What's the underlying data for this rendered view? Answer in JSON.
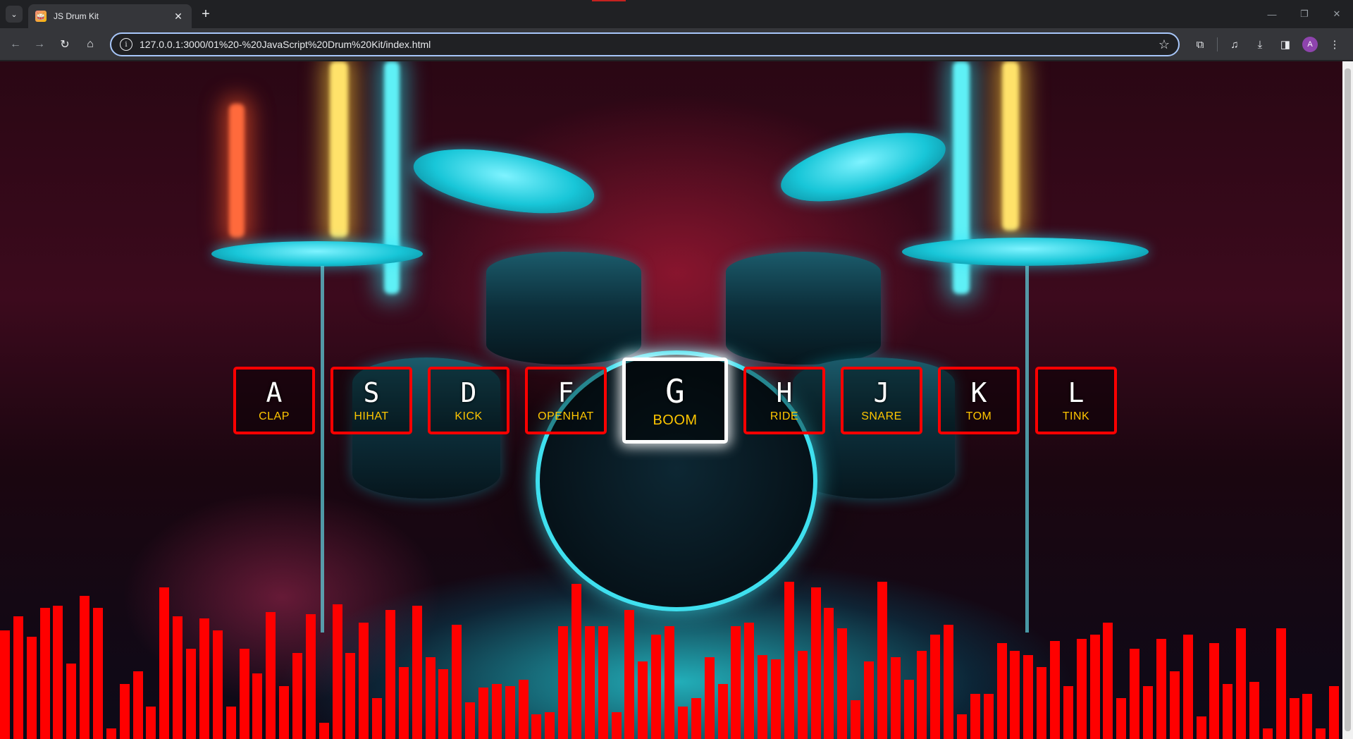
{
  "browser": {
    "tab_title": "JS Drum Kit",
    "tab_close": "✕",
    "new_tab": "+",
    "url": "127.0.0.1:3000/01%20-%20JavaScript%20Drum%20Kit/index.html",
    "avatar_letter": "A",
    "icons": [
      "back-icon",
      "forward-icon",
      "reload-icon",
      "home-icon",
      "site-info-icon",
      "bookmark-star-icon",
      "extensions-icon",
      "media-controls-icon",
      "downloads-icon",
      "side-panel-icon",
      "avatar",
      "menu-icon"
    ]
  },
  "keys": [
    {
      "key": "A",
      "sound": "clap",
      "playing": false
    },
    {
      "key": "S",
      "sound": "hihat",
      "playing": false
    },
    {
      "key": "D",
      "sound": "kick",
      "playing": false
    },
    {
      "key": "F",
      "sound": "openhat",
      "playing": false
    },
    {
      "key": "G",
      "sound": "boom",
      "playing": true
    },
    {
      "key": "H",
      "sound": "ride",
      "playing": false
    },
    {
      "key": "J",
      "sound": "snare",
      "playing": false
    },
    {
      "key": "K",
      "sound": "tom",
      "playing": false
    },
    {
      "key": "L",
      "sound": "tink",
      "playing": false
    }
  ],
  "visualizer": {
    "color": "#ff0000",
    "levels": [
      0.53,
      0.6,
      0.5,
      0.64,
      0.65,
      0.37,
      0.7,
      0.64,
      0.05,
      0.27,
      0.33,
      0.16,
      0.74,
      0.6,
      0.44,
      0.59,
      0.53,
      0.16,
      0.44,
      0.32,
      0.62,
      0.26,
      0.42,
      0.61,
      0.08,
      0.66,
      0.42,
      0.57,
      0.2,
      0.63,
      0.35,
      0.65,
      0.4,
      0.34,
      0.56,
      0.18,
      0.25,
      0.27,
      0.26,
      0.29,
      0.12,
      0.13,
      0.55,
      0.76,
      0.55,
      0.55,
      0.13,
      0.63,
      0.38,
      0.51,
      0.55,
      0.16,
      0.2,
      0.4,
      0.27,
      0.55,
      0.57,
      0.41,
      0.39,
      0.77,
      0.43,
      0.74,
      0.64,
      0.54,
      0.19,
      0.38,
      0.77,
      0.4,
      0.29,
      0.43,
      0.51,
      0.56,
      0.12,
      0.22,
      0.22,
      0.47,
      0.43,
      0.41,
      0.35,
      0.48,
      0.26,
      0.49,
      0.51,
      0.57,
      0.2,
      0.44,
      0.26,
      0.49,
      0.33,
      0.51,
      0.11,
      0.47,
      0.27,
      0.54,
      0.28,
      0.05,
      0.54,
      0.2,
      0.22,
      0.05,
      0.26
    ]
  }
}
